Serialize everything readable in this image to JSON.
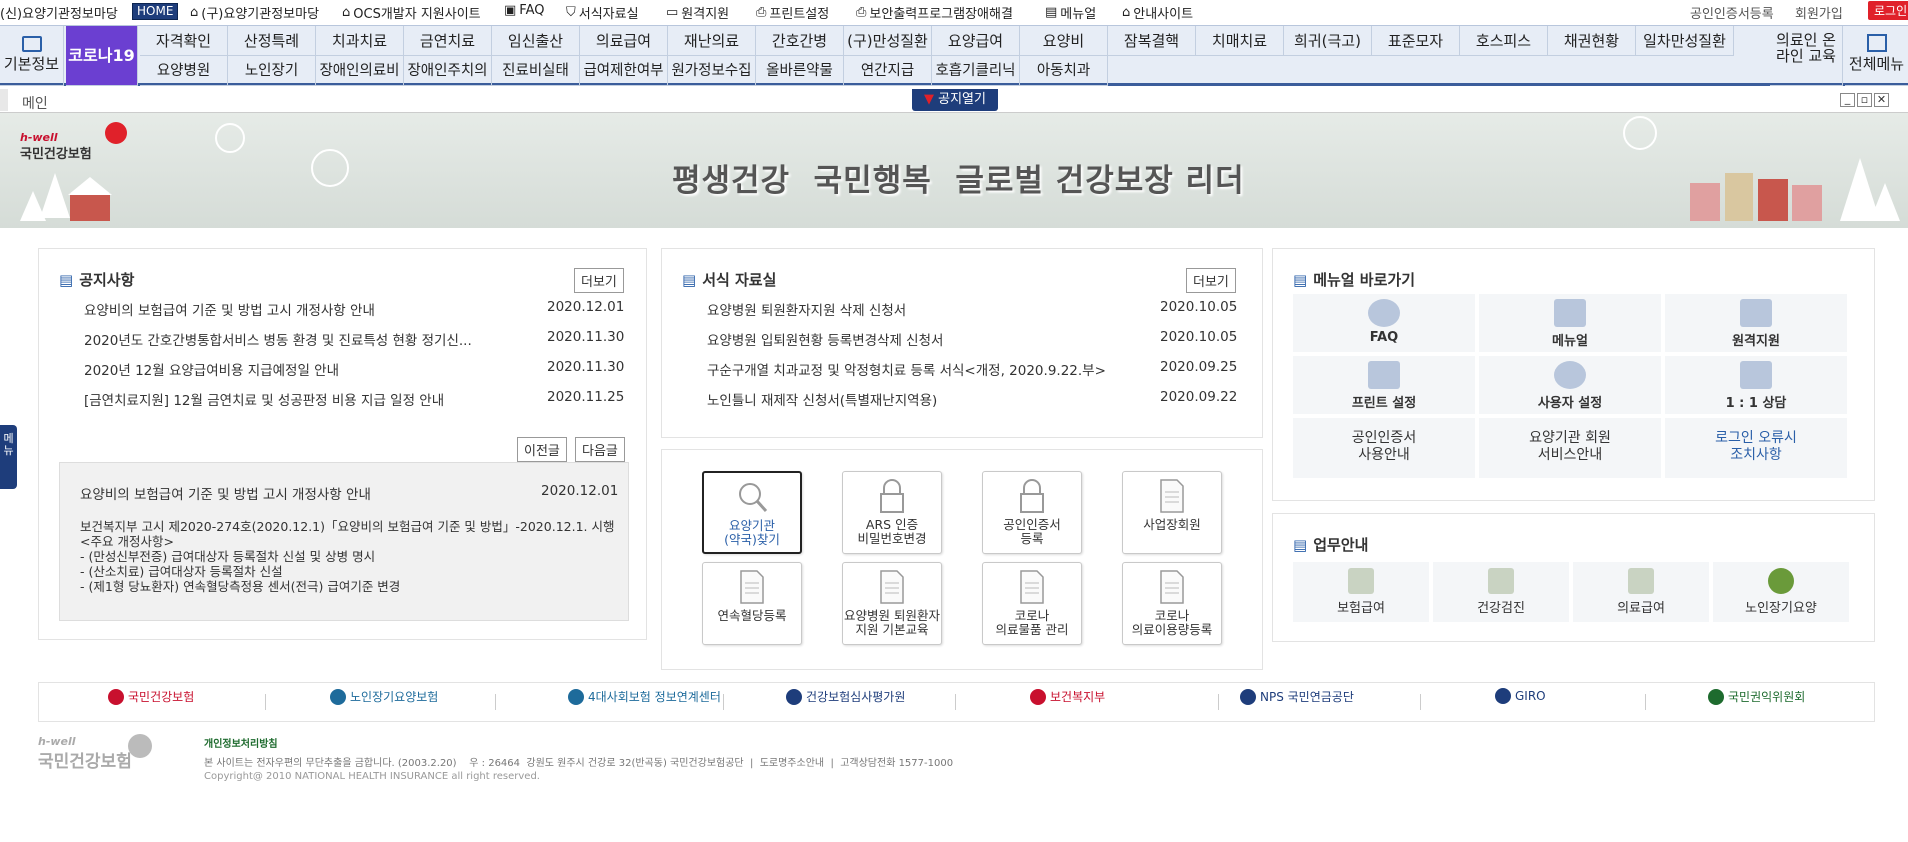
{
  "topbar": {
    "title": "(신)요양기관정보마당",
    "home": "HOME",
    "links": [
      "(구)요양기관정보마당",
      "OCS개발자 지원사이트",
      "FAQ",
      "서식자료실",
      "원격지원",
      "프린트설정",
      "보안출력프로그램장애해결",
      "메뉴얼",
      "안내사이트"
    ],
    "cert": "공인인증서등록",
    "join": "회원가입",
    "login": "로그인"
  },
  "menu": {
    "basic": "기본정보",
    "covid": "코로나19",
    "row1": [
      "자격확인",
      "산정특례",
      "치과치료",
      "금연치료",
      "임신출산",
      "의료급여",
      "재난의료",
      "간호간병",
      "(구)만성질환",
      "요양급여",
      "요양비",
      "잠복결핵",
      "치매치료",
      "희귀(극고)",
      "표준모자",
      "호스피스",
      "채권현황",
      "일차만성질환"
    ],
    "row2": [
      "요양병원",
      "노인장기",
      "장애인의료비",
      "장애인주치의",
      "진료비실태",
      "급여제한여부",
      "원가정보수집",
      "올바른약물",
      "연간지급",
      "호흡기클리닉",
      "아동치과"
    ],
    "medical": "의료인 온라인 교육",
    "all": "전체메뉴"
  },
  "subbar": {
    "tab": "메인",
    "notice_open": "공지열기",
    "side": "메뉴"
  },
  "banner": {
    "brand_small": "h-well",
    "brand": "국민건강보험",
    "slogan": "평생건강  국민행복  글로벌 건강보장 리더"
  },
  "notice": {
    "title": "공지사항",
    "more": "더보기",
    "prev": "이전글",
    "next": "다음글",
    "items": [
      {
        "t": "요양비의 보험급여 기준 및 방법 고시 개정사항 안내",
        "d": "2020.12.01"
      },
      {
        "t": "2020년도 간호간병통합서비스 병동 환경 및 진료특성 현황 정기신...",
        "d": "2020.11.30"
      },
      {
        "t": "2020년 12월 요양급여비용 지급예정일 안내",
        "d": "2020.11.30"
      },
      {
        "t": "[금연치료지원] 12월 금연치료 및 성공판정 비용 지급 일정 안내",
        "d": "2020.11.25"
      }
    ],
    "detail": {
      "title": "요양비의 보험급여 기준 및 방법 고시 개정사항 안내",
      "date": "2020.12.01",
      "lines": [
        "보건복지부 고시 제2020-274호(2020.12.1)「요양비의 보험급여 기준 및 방법」-2020.12.1. 시행",
        "<주요 개정사항>",
        "- (만성신부전증) 급여대상자 등록절차 신설 및 상병 명시",
        "- (산소치료) 급여대상자 등록절차 신설",
        "- (제1형 당뇨환자) 연속혈당측정용 센서(전극) 급여기준 변경"
      ]
    }
  },
  "forms": {
    "title": "서식 자료실",
    "more": "더보기",
    "items": [
      {
        "t": "요양병원 퇴원환자지원 삭제 신청서",
        "d": "2020.10.05"
      },
      {
        "t": "요양병원 입퇴원현황 등록변경삭제 신청서",
        "d": "2020.10.05"
      },
      {
        "t": "구순구개열 치과교정 및 악정형치료 등록 서식<개정, 2020.9.22.부>",
        "d": "2020.09.25"
      },
      {
        "t": "노인틀니 재제작 신청서(특별재난지역용)",
        "d": "2020.09.22"
      }
    ]
  },
  "quick": [
    {
      "l1": "요양기관",
      "l2": "(약국)찾기",
      "icon": "search-icon"
    },
    {
      "l1": "ARS 인증",
      "l2": "비밀번호변경",
      "icon": "lock-icon"
    },
    {
      "l1": "공인인증서",
      "l2": "등록",
      "icon": "lock-icon"
    },
    {
      "l1": "사업장회원",
      "l2": "",
      "icon": "document-icon"
    },
    {
      "l1": "연속혈당등록",
      "l2": "",
      "icon": "document-icon"
    },
    {
      "l1": "요양병원 퇴원환자",
      "l2": "지원 기본교육",
      "icon": "document-icon"
    },
    {
      "l1": "코로나",
      "l2": "의료물품 관리",
      "icon": "document-icon"
    },
    {
      "l1": "코로나",
      "l2": "의료이용량등록",
      "icon": "document-icon"
    }
  ],
  "manual": {
    "title": "메뉴얼 바로가기",
    "items": [
      "FAQ",
      "메뉴얼",
      "원격지원",
      "프린트 설정",
      "사용자 설정",
      "1 : 1 상담"
    ],
    "text_items": [
      [
        "공인인증서",
        "사용안내"
      ],
      [
        "요양기관 회원",
        "서비스안내"
      ],
      [
        "로그인 오류시",
        "조치사항"
      ]
    ]
  },
  "business": {
    "title": "업무안내",
    "items": [
      "보험급여",
      "건강검진",
      "의료급여",
      "노인장기요양"
    ]
  },
  "footer": {
    "logos": [
      "국민건강보험",
      "노인장기요양보험",
      "4대사회보험 정보연계센터",
      "건강보험심사평가원",
      "보건복지부",
      "NPS 국민연금공단",
      "GIRO",
      "국민권익위원회"
    ],
    "privacy": "개인정보처리방침",
    "line1": "본 사이트는 전자우편의 무단추출을 금합니다. (2003.2.20)    우 : 26464  강원도 원주시 건강로 32(반곡동) 국민건강보험공단  |  도로명주소안내  |  고객상담전화 1577-1000",
    "copyright": "Copyright@ 2010 NATIONAL HEALTH INSURANCE all right reserved.",
    "brand_small": "h-well",
    "brand": "국민건강보험"
  },
  "colors": {
    "navy": "#1e3d7b",
    "purple": "#6b3fd1",
    "red": "#e0212a",
    "accent": "#2a5fa8"
  }
}
